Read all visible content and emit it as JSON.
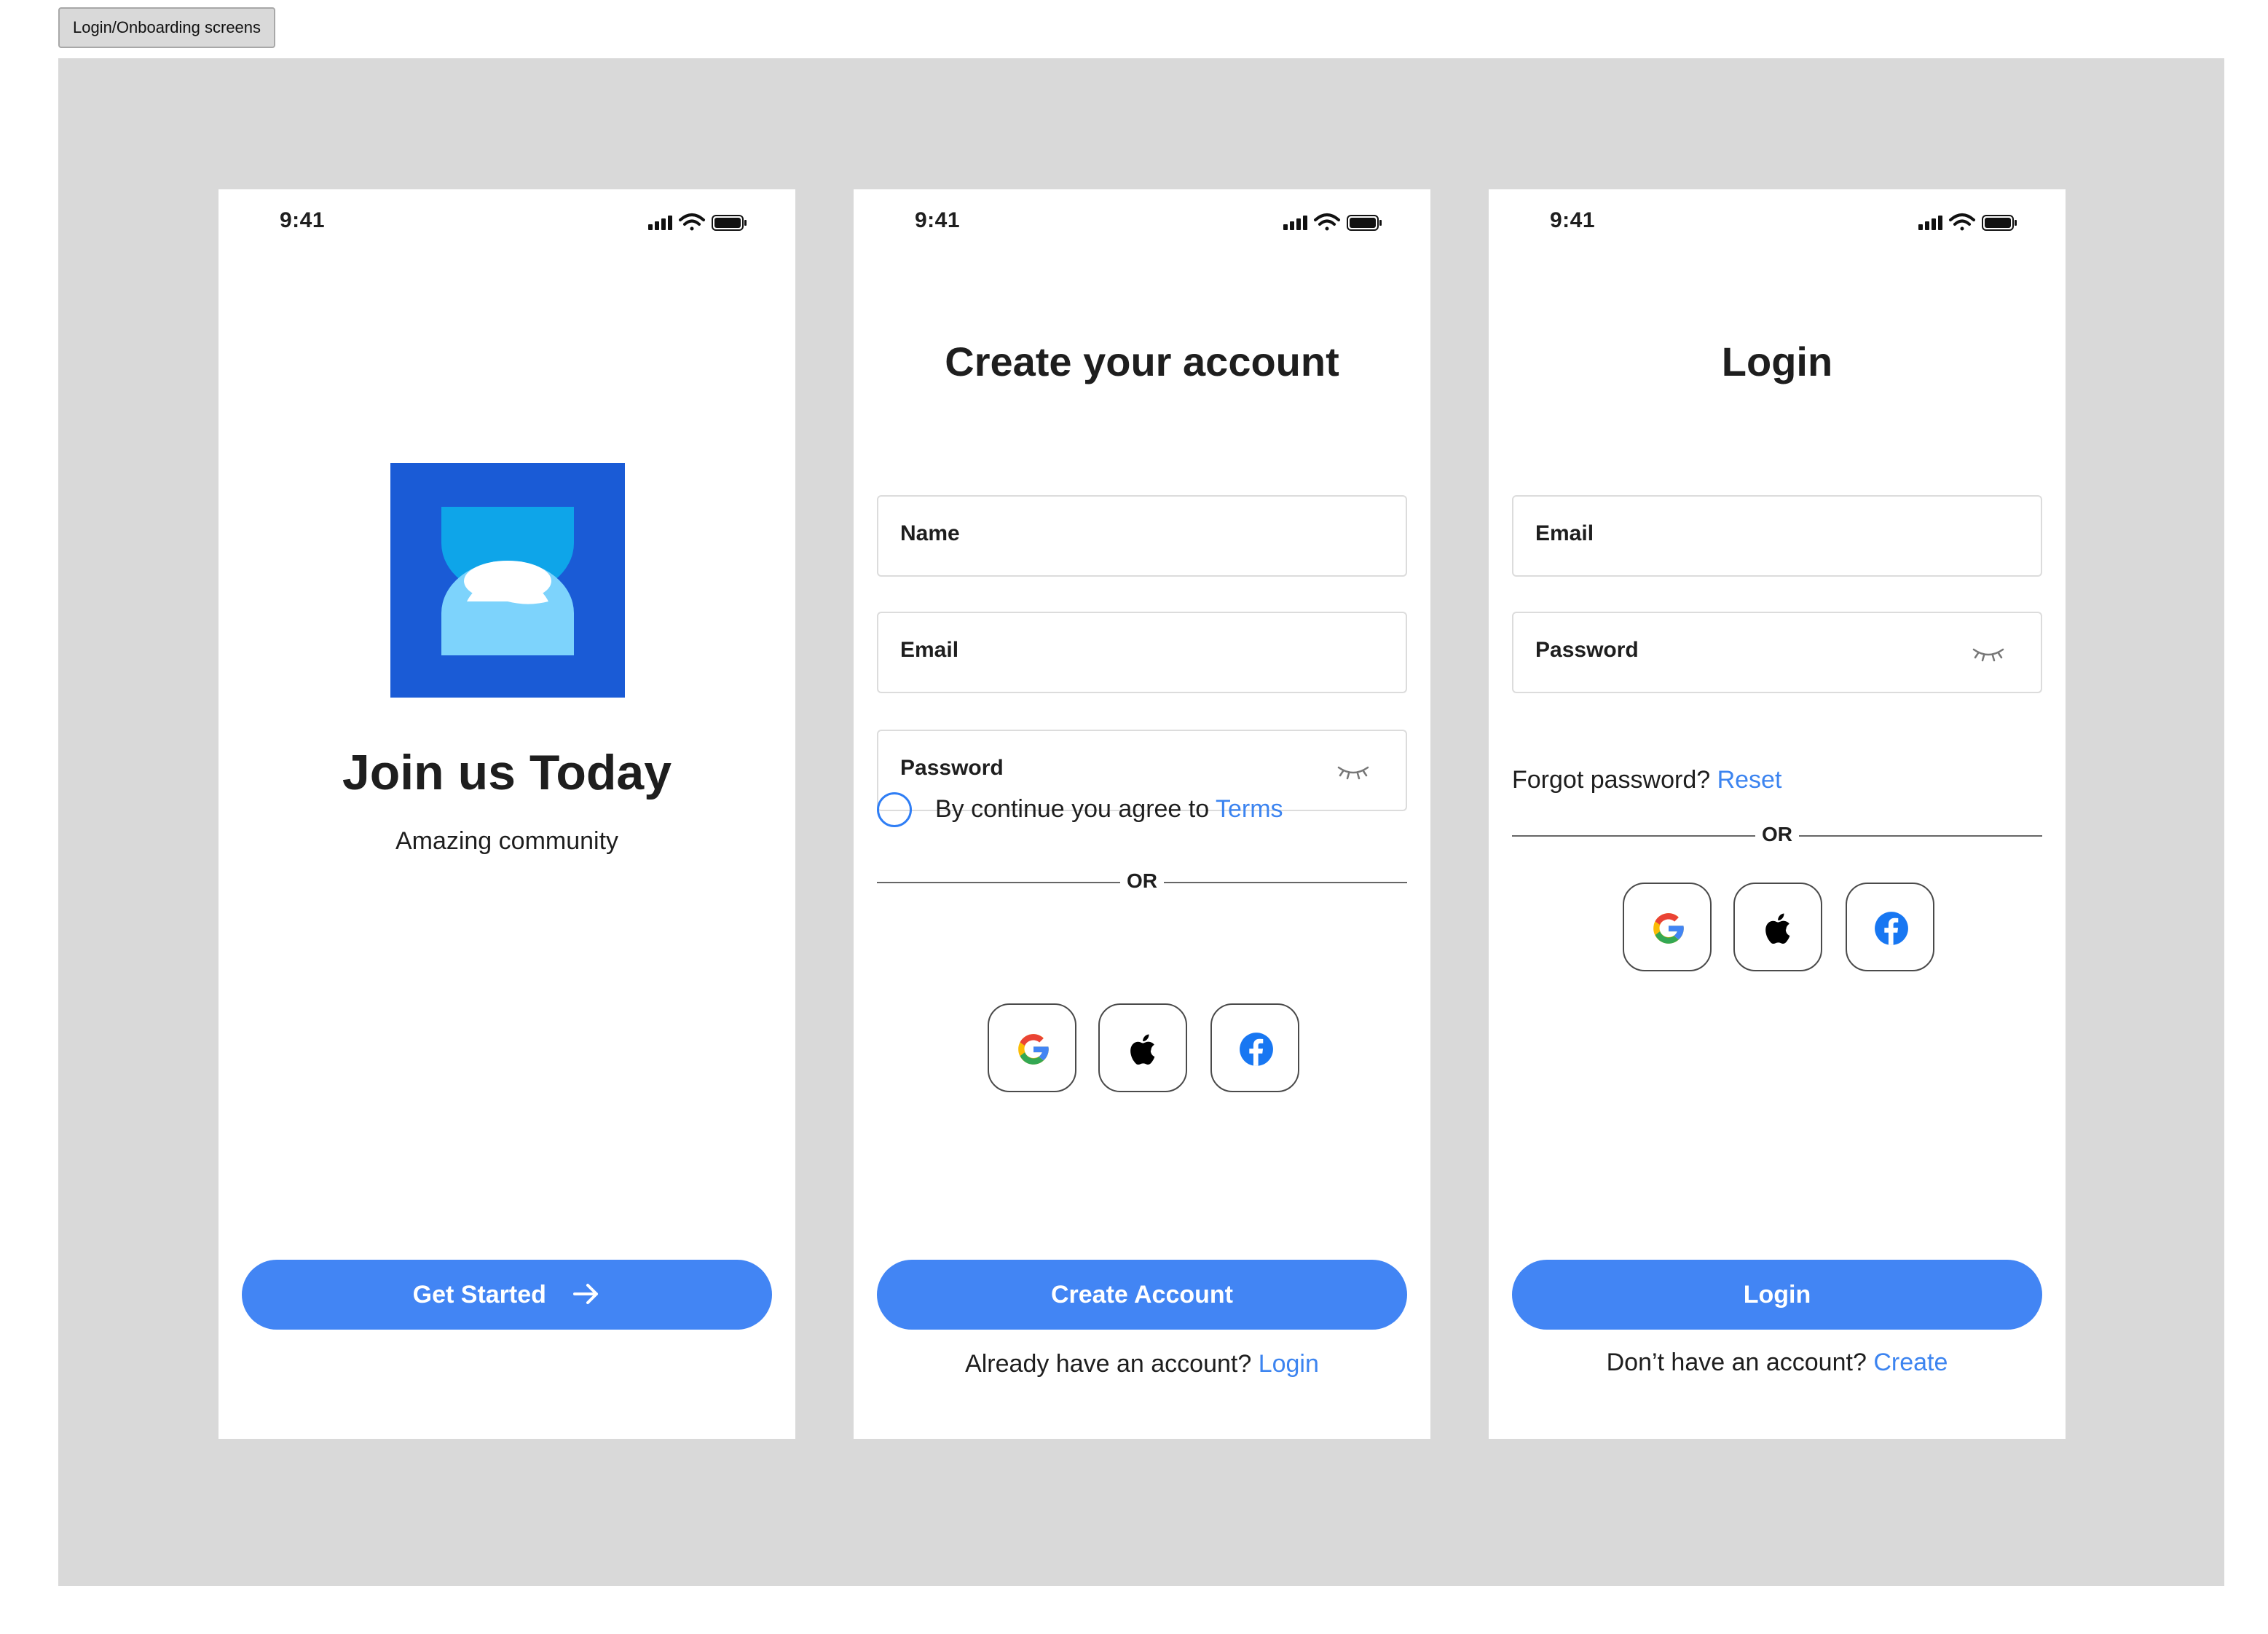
{
  "canvas_label": "Login/Onboarding screens",
  "status_bar": {
    "time": "9:41"
  },
  "welcome": {
    "title": "Join us Today",
    "subtitle": "Amazing community",
    "button_label": "Get Started"
  },
  "signup": {
    "title": "Create your account",
    "fields": {
      "name": "Name",
      "email": "Email",
      "password": "Password"
    },
    "agree_prefix": "By continue you agree to",
    "agree_link": "Terms",
    "divider": "OR",
    "button_label": "Create Account",
    "footer_prefix": "Already have an account?",
    "footer_link": "Login"
  },
  "login": {
    "title": "Login",
    "fields": {
      "email": "Email",
      "password": "Password"
    },
    "forgot_prefix": "Forgot password?",
    "forgot_link": "Reset",
    "divider": "OR",
    "button_label": "Login",
    "footer_prefix": "Don’t have an account?",
    "footer_link": "Create"
  },
  "social": [
    "google-icon",
    "apple-icon",
    "facebook-icon"
  ],
  "colors": {
    "primary": "#4285f4",
    "link": "#3c84f0",
    "logo_bg": "#1a5bd6",
    "logo_top": "#0ea5e9",
    "logo_bottom": "#7dd3fc",
    "canvas": "#d9d9d9"
  }
}
